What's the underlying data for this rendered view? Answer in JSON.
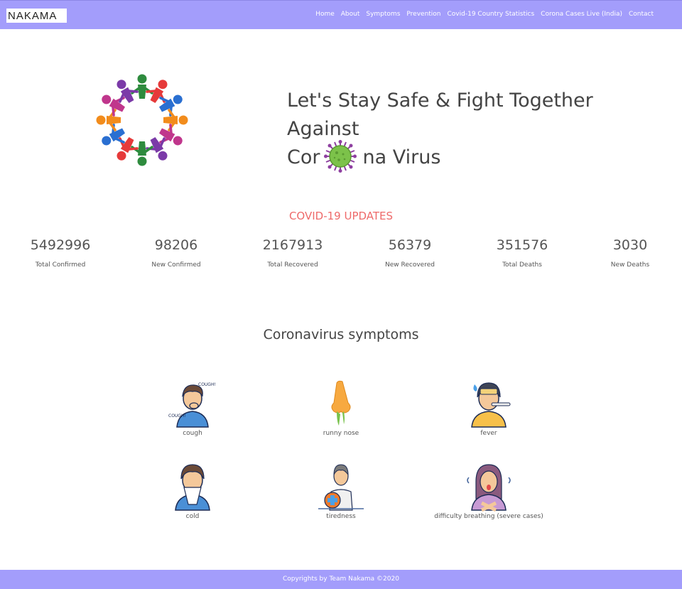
{
  "brand": {
    "logo_text": "NAKAMA"
  },
  "nav": {
    "items": [
      "Home",
      "About",
      "Symptoms",
      "Prevention",
      "Covid-19 Country Statistics",
      "Corona Cases Live (India)",
      "Contact"
    ]
  },
  "hero": {
    "title_line1": "Let's Stay Safe & Fight Together Against",
    "title_line2_a": "Cor",
    "title_line2_b": "na Virus"
  },
  "updates": {
    "title": "COVID-19 UPDATES",
    "stats": [
      {
        "value": "5492996",
        "label": "Total Confirmed"
      },
      {
        "value": "98206",
        "label": "New Confirmed"
      },
      {
        "value": "2167913",
        "label": "Total Recovered"
      },
      {
        "value": "56379",
        "label": "New Recovered"
      },
      {
        "value": "351576",
        "label": "Total Deaths"
      },
      {
        "value": "3030",
        "label": "New Deaths"
      }
    ]
  },
  "symptoms": {
    "title": "Coronavirus symptoms",
    "items": [
      {
        "label": "cough",
        "icon": "cough-icon",
        "bubble": "COUGH!"
      },
      {
        "label": "runny nose",
        "icon": "runny-nose-icon"
      },
      {
        "label": "fever",
        "icon": "fever-icon"
      },
      {
        "label": "cold",
        "icon": "cold-icon"
      },
      {
        "label": "tiredness",
        "icon": "tiredness-icon"
      },
      {
        "label": "difficulty breathing (severe cases)",
        "icon": "difficulty-breathing-icon"
      }
    ]
  },
  "footer": {
    "text": "Copyrights by Team Nakama ©2020"
  },
  "colors": {
    "navbar": "#a39dfb",
    "updates_title": "#ee6a6a",
    "footer": "#a39dfb"
  }
}
